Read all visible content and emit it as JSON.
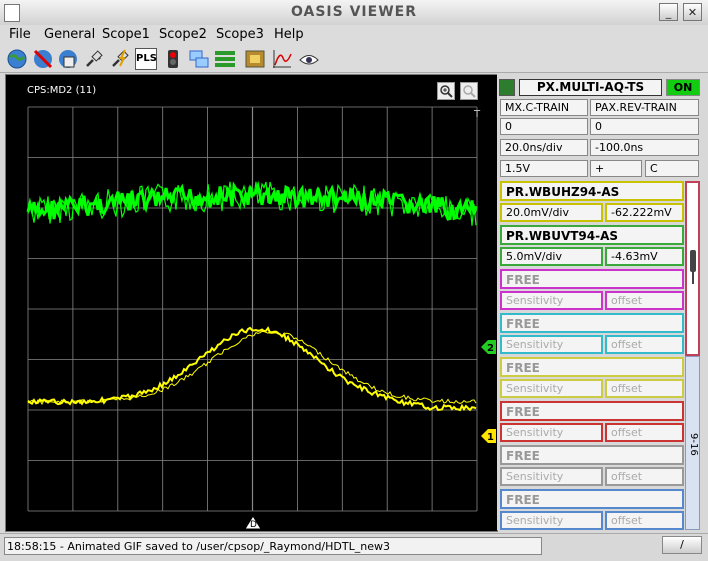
{
  "window": {
    "title": "OASIS VIEWER",
    "minimize": "_",
    "close": "✕"
  },
  "menu": [
    "File",
    "General",
    "Scope1",
    "Scope2",
    "Scope3",
    "Help"
  ],
  "toolbar": {
    "pls_label": "PLS"
  },
  "scope": {
    "label": "CPS:MD2 (11)",
    "trigger_marker": "T",
    "ch1_marker": "1",
    "ch2_marker": "2",
    "delay_marker": "D",
    "colors": {
      "ch1": "#ffff00",
      "ch2": "#00ff00",
      "grid": "#888888",
      "marker_ch1": "#ffe400",
      "marker_ch2": "#22cc22"
    }
  },
  "panel": {
    "device": "PX.MULTI-AQ-TS",
    "on_label": "ON",
    "trig1_name": "MX.C-TRAIN",
    "trig2_name": "PAX.REV-TRAIN",
    "trig1_value": "0",
    "trig2_value": "0",
    "timebase": "20.0ns/div",
    "delay": "-100.0ns",
    "trigger_level": "1.5V",
    "trigger_slope": "+",
    "coupling": "C",
    "channels": [
      {
        "name": "PR.WBUHZ94-AS",
        "sensitivity": "20.0mV/div",
        "offset": "-62.222mV",
        "color": "#c9c200"
      },
      {
        "name": "PR.WBUVT94-AS",
        "sensitivity": "5.0mV/div",
        "offset": "-4.63mV",
        "color": "#3aa83a"
      },
      {
        "name": "FREE",
        "sensitivity": "Sensitivity",
        "offset": "offset",
        "color": "#cc33cc"
      },
      {
        "name": "FREE",
        "sensitivity": "Sensitivity",
        "offset": "offset",
        "color": "#33bbcc"
      },
      {
        "name": "FREE",
        "sensitivity": "Sensitivity",
        "offset": "offset",
        "color": "#cccc44"
      },
      {
        "name": "FREE",
        "sensitivity": "Sensitivity",
        "offset": "offset",
        "color": "#cc3333"
      },
      {
        "name": "FREE",
        "sensitivity": "Sensitivity",
        "offset": "offset",
        "color": "#999999"
      },
      {
        "name": "FREE",
        "sensitivity": "Sensitivity",
        "offset": "offset",
        "color": "#5588cc"
      }
    ],
    "side_tab_label": "9-16",
    "side_accent": "#c04058"
  },
  "status": {
    "message": "18:58:15 - Animated GIF saved to /user/cpsop/_Raymond/HDTL_new3",
    "button": "/"
  }
}
